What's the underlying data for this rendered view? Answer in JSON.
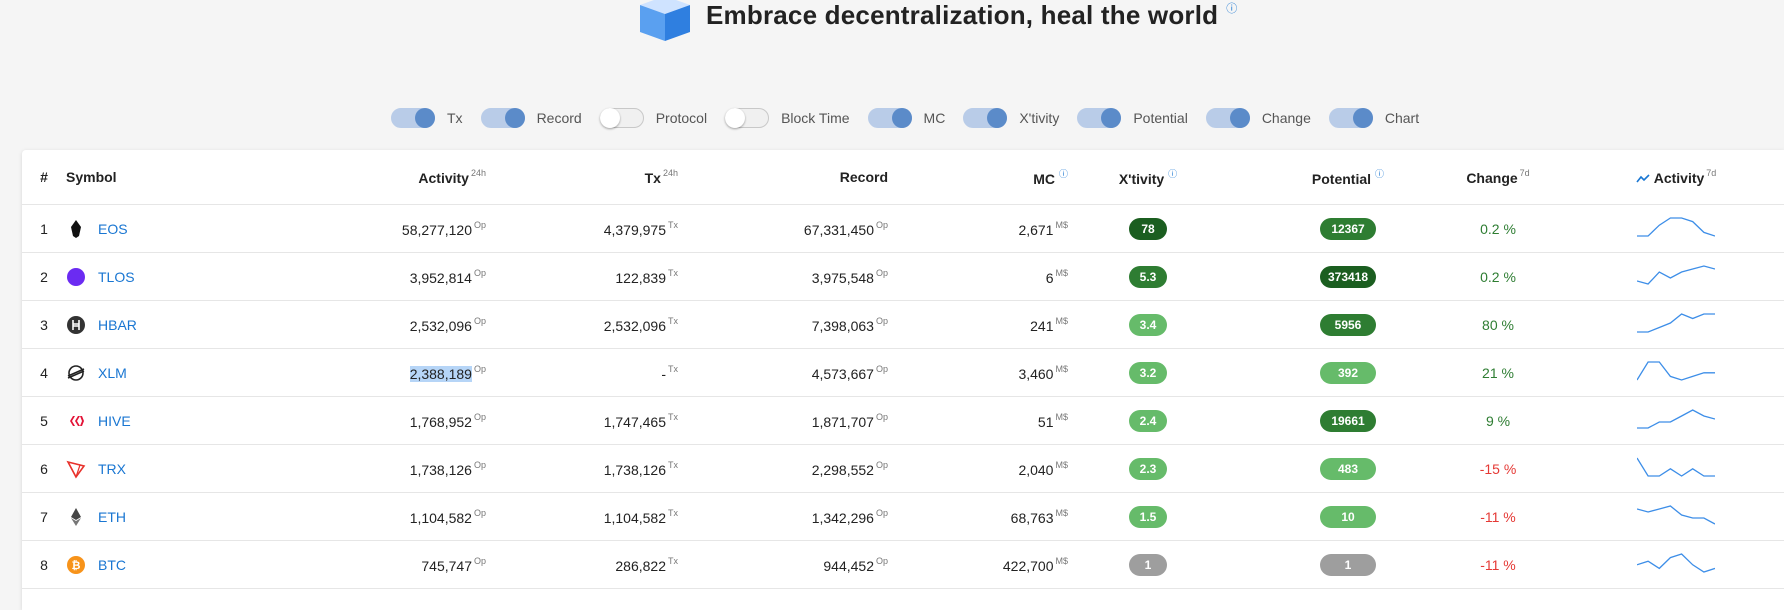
{
  "header": {
    "title": "Embrace decentralization, heal the world",
    "info_icon": "info-icon"
  },
  "toggles": [
    {
      "label": "Tx",
      "on": true
    },
    {
      "label": "Record",
      "on": true
    },
    {
      "label": "Protocol",
      "on": false
    },
    {
      "label": "Block Time",
      "on": false
    },
    {
      "label": "MC",
      "on": true
    },
    {
      "label": "X'tivity",
      "on": true
    },
    {
      "label": "Potential",
      "on": true
    },
    {
      "label": "Change",
      "on": true
    },
    {
      "label": "Chart",
      "on": true
    }
  ],
  "table": {
    "headers": {
      "rank": "#",
      "symbol": "Symbol",
      "activity": "Activity",
      "activity_sup": "24h",
      "tx": "Tx",
      "tx_sup": "24h",
      "record": "Record",
      "mc": "MC",
      "xtivity": "X'tivity",
      "potential": "Potential",
      "change": "Change",
      "change_sup": "7d",
      "chart": "Activity",
      "chart_sup": "7d"
    },
    "units": {
      "op": "Op",
      "tx": "Tx",
      "ms": "M$"
    },
    "rows": [
      {
        "rank": "1",
        "symbol": "EOS",
        "activity": "58,277,120",
        "tx": "4,379,975",
        "record": "67,331,450",
        "mc": "2,671",
        "xtivity": "78",
        "xtivity_tone": "dk",
        "potential": "12367",
        "potential_tone": "md",
        "change": "0.2 %",
        "change_dir": "pos",
        "spark": [
          1,
          1,
          4,
          6,
          6,
          5,
          2,
          1
        ]
      },
      {
        "rank": "2",
        "symbol": "TLOS",
        "activity": "3,952,814",
        "tx": "122,839",
        "record": "3,975,548",
        "mc": "6",
        "xtivity": "5.3",
        "xtivity_tone": "md",
        "potential": "373418",
        "potential_tone": "dk",
        "change": "0.2 %",
        "change_dir": "pos",
        "spark": [
          1,
          0,
          4,
          2,
          4,
          5,
          6,
          5
        ]
      },
      {
        "rank": "3",
        "symbol": "HBAR",
        "activity": "2,532,096",
        "tx": "2,532,096",
        "record": "7,398,063",
        "mc": "241",
        "xtivity": "3.4",
        "xtivity_tone": "lt",
        "potential": "5956",
        "potential_tone": "md",
        "change": "80 %",
        "change_dir": "pos",
        "spark": [
          0,
          0,
          1,
          2,
          4,
          3,
          4,
          4
        ]
      },
      {
        "rank": "4",
        "symbol": "XLM",
        "activity": "2,388,189",
        "tx": "-",
        "record": "4,573,667",
        "mc": "3,460",
        "xtivity": "3.2",
        "xtivity_tone": "lt",
        "potential": "392",
        "potential_tone": "lt",
        "change": "21 %",
        "change_dir": "pos",
        "spark": [
          1,
          6,
          6,
          2,
          1,
          2,
          3,
          3
        ]
      },
      {
        "rank": "5",
        "symbol": "HIVE",
        "activity": "1,768,952",
        "tx": "1,747,465",
        "record": "1,871,707",
        "mc": "51",
        "xtivity": "2.4",
        "xtivity_tone": "lt",
        "potential": "19661",
        "potential_tone": "md",
        "change": "9 %",
        "change_dir": "pos",
        "spark": [
          0,
          0,
          2,
          2,
          4,
          6,
          4,
          3
        ]
      },
      {
        "rank": "6",
        "symbol": "TRX",
        "activity": "1,738,126",
        "tx": "1,738,126",
        "record": "2,298,552",
        "mc": "2,040",
        "xtivity": "2.3",
        "xtivity_tone": "lt",
        "potential": "483",
        "potential_tone": "lt",
        "change": "-15 %",
        "change_dir": "neg",
        "spark": [
          6,
          1,
          1,
          3,
          1,
          3,
          1,
          1
        ]
      },
      {
        "rank": "7",
        "symbol": "ETH",
        "activity": "1,104,582",
        "tx": "1,104,582",
        "record": "1,342,296",
        "mc": "68,763",
        "xtivity": "1.5",
        "xtivity_tone": "lt",
        "potential": "10",
        "potential_tone": "lt",
        "change": "-11 %",
        "change_dir": "neg",
        "spark": [
          5,
          4,
          5,
          6,
          3,
          2,
          2,
          0
        ]
      },
      {
        "rank": "8",
        "symbol": "BTC",
        "activity": "745,747",
        "tx": "286,822",
        "record": "944,452",
        "mc": "422,700",
        "xtivity": "1",
        "xtivity_tone": "gr",
        "potential": "1",
        "potential_tone": "gr",
        "change": "-11 %",
        "change_dir": "neg",
        "spark": [
          2,
          3,
          1,
          4,
          5,
          2,
          0,
          1
        ]
      }
    ]
  }
}
